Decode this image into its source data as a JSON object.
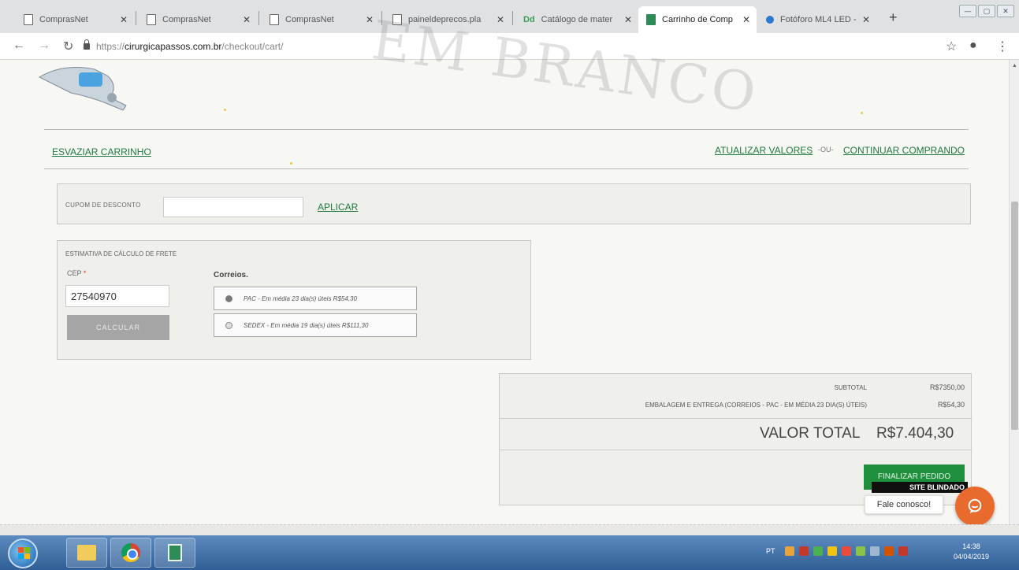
{
  "browser": {
    "tabs": [
      {
        "title": "ComprasNet",
        "icon": "page-icon"
      },
      {
        "title": "ComprasNet",
        "icon": "page-icon"
      },
      {
        "title": "ComprasNet",
        "icon": "page-icon"
      },
      {
        "title": "paineldeprecos.pla",
        "icon": "page-icon"
      },
      {
        "title": "Catálogo de mater",
        "icon": "dq-icon"
      },
      {
        "title": "Carrinho de Comp",
        "icon": "store-icon",
        "active": true
      },
      {
        "title": "Fotóforo ML4 LED -",
        "icon": "globe-icon"
      }
    ],
    "url": {
      "protocol": "https://",
      "host": "cirurgicapassos.com.br",
      "path": "/checkout/cart/"
    }
  },
  "watermark": "EM BRANCO",
  "cart": {
    "empty_cart": "ESVAZIAR CARRINHO",
    "update_values": "ATUALIZAR VALORES",
    "or": "-OU-",
    "continue_shopping": "CONTINUAR COMPRANDO"
  },
  "coupon": {
    "label": "CUPOM DE DESCONTO",
    "value": "",
    "apply": "APLICAR"
  },
  "shipping": {
    "title": "ESTIMATIVA DE CÁLCULO DE FRETE",
    "cep_label": "CEP",
    "required_mark": "*",
    "cep_value": "27540970",
    "calculate": "CALCULAR",
    "carrier": "Correios.",
    "options": [
      {
        "label": "PAC - Em média 23 dia(s) úteis R$54,30",
        "selected": true
      },
      {
        "label": "SEDEX - Em média 19 dia(s) úteis R$111,30",
        "selected": false
      }
    ]
  },
  "totals": {
    "subtotal_label": "SUBTOTAL",
    "subtotal_value": "R$7350,00",
    "shipping_label": "EMBALAGEM E ENTREGA (CORREIOS - PAC - EM MÉDIA 23 DIA(S) ÚTEIS)",
    "shipping_value": "R$54,30",
    "grand_label": "VALOR TOTAL",
    "grand_value": "R$7.404,30",
    "finalize": "FINALIZAR PEDIDO",
    "badge": "SITE BLINDADO"
  },
  "chat": {
    "label": "Fale conosco!"
  },
  "taskbar": {
    "lang": "PT",
    "time": "14:38",
    "date": "04/04/2019"
  },
  "colors": {
    "link": "#1f7a3f",
    "finalize": "#1f8f3e",
    "chat": "#e86a2c"
  }
}
